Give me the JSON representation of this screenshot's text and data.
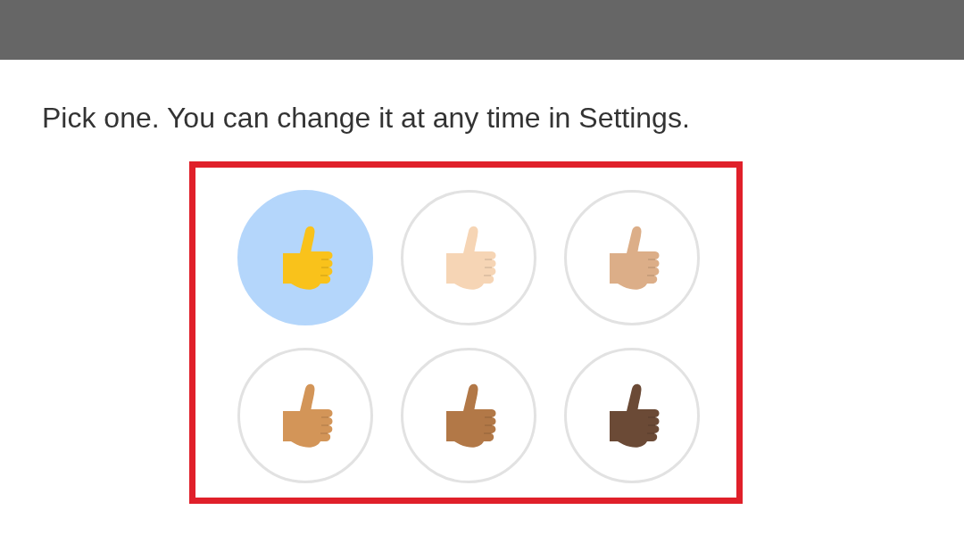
{
  "prompt": "Pick one. You can change it at any time in Settings.",
  "options": [
    {
      "selected": true,
      "color": "#f9c21b"
    },
    {
      "selected": false,
      "color": "#f6d5b5"
    },
    {
      "selected": false,
      "color": "#dcae88"
    },
    {
      "selected": false,
      "color": "#d39558"
    },
    {
      "selected": false,
      "color": "#b27847"
    },
    {
      "selected": false,
      "color": "#6b4a36"
    }
  ]
}
